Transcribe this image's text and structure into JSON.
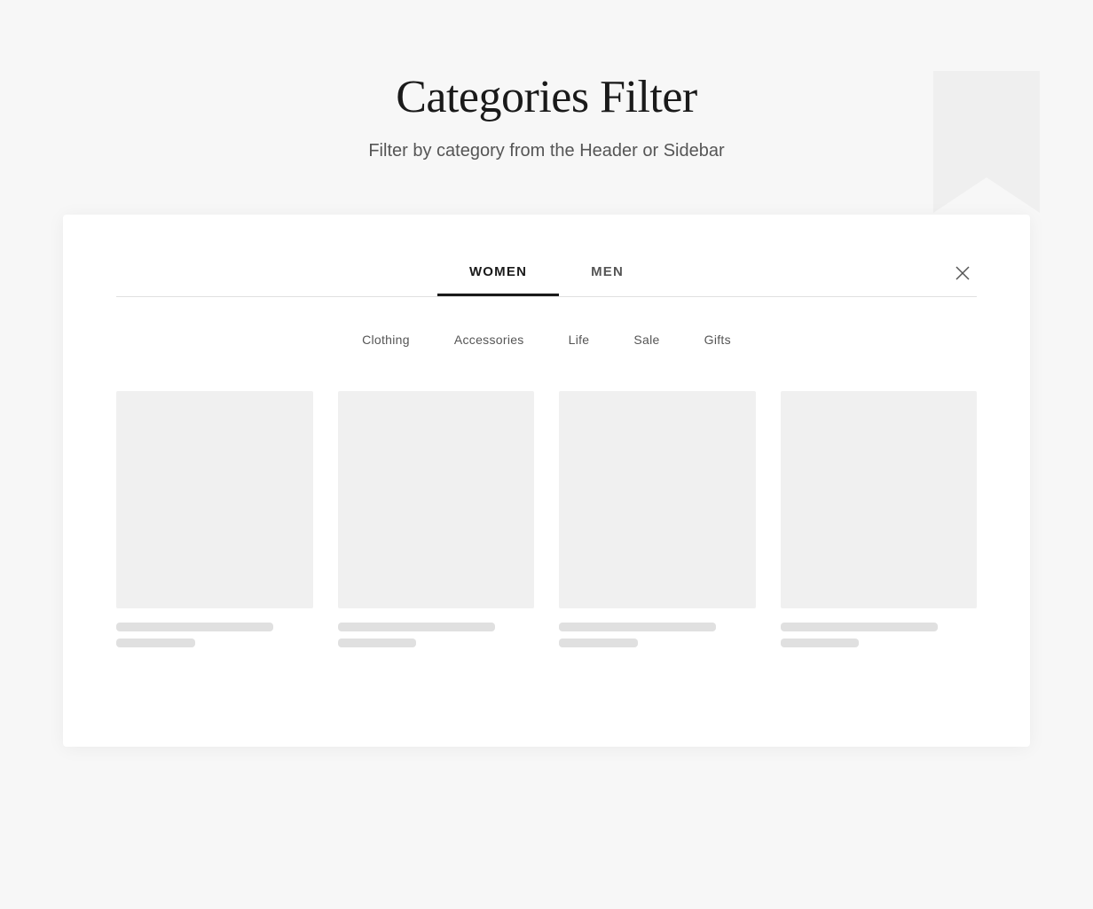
{
  "page": {
    "title": "Categories Filter",
    "subtitle": "Filter by category from the Header or Sidebar",
    "background_color": "#f7f7f7"
  },
  "modal": {
    "tabs": [
      {
        "id": "women",
        "label": "WOMEN",
        "active": true
      },
      {
        "id": "men",
        "label": "MEN",
        "active": false
      }
    ],
    "close_label": "×",
    "categories": [
      {
        "id": "clothing",
        "label": "Clothing"
      },
      {
        "id": "accessories",
        "label": "Accessories"
      },
      {
        "id": "life",
        "label": "Life"
      },
      {
        "id": "sale",
        "label": "Sale"
      },
      {
        "id": "gifts",
        "label": "Gifts"
      }
    ],
    "products": [
      {
        "id": "product-1"
      },
      {
        "id": "product-2"
      },
      {
        "id": "product-3"
      },
      {
        "id": "product-4"
      }
    ]
  },
  "icons": {
    "close": "×"
  }
}
